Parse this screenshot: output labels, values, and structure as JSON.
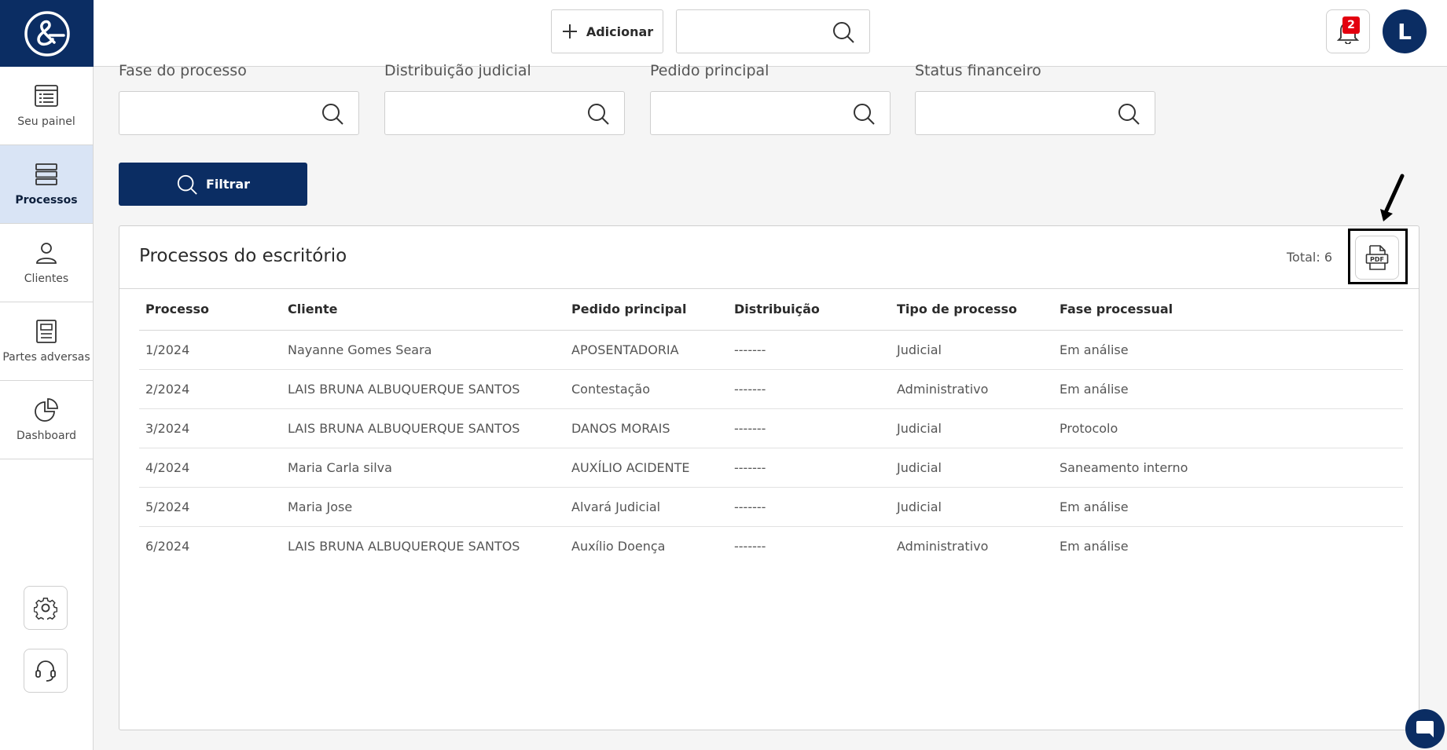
{
  "sidebar": {
    "logo": "ampersand-logo",
    "items": [
      {
        "label": "Seu painel",
        "icon": "list-icon",
        "active": false
      },
      {
        "label": "Processos",
        "icon": "stack-icon",
        "active": true
      },
      {
        "label": "Clientes",
        "icon": "user-icon",
        "active": false
      },
      {
        "label": "Partes adversas",
        "icon": "document-icon",
        "active": false
      },
      {
        "label": "Dashboard",
        "icon": "pie-chart-icon",
        "active": false
      }
    ],
    "bottom_buttons": [
      "gear-icon",
      "headset-icon"
    ]
  },
  "topbar": {
    "add_label": "Adicionar",
    "search_placeholder": "",
    "notifications_count": "2",
    "avatar_initial": "L"
  },
  "filters": {
    "fields": [
      {
        "label": "Fase do processo",
        "value": ""
      },
      {
        "label": "Distribuição judicial",
        "value": ""
      },
      {
        "label": "Pedido principal",
        "value": ""
      },
      {
        "label": "Status financeiro",
        "value": ""
      }
    ],
    "filter_button": "Filtrar"
  },
  "panel": {
    "title": "Processos do escritório",
    "total": "Total: 6",
    "columns": [
      "Processo",
      "Cliente",
      "Pedido principal",
      "Distribuição",
      "Tipo de processo",
      "Fase processual"
    ],
    "rows": [
      [
        "1/2024",
        "Nayanne Gomes Seara",
        "APOSENTADORIA",
        "-------",
        "Judicial",
        "Em análise"
      ],
      [
        "2/2024",
        "LAIS BRUNA ALBUQUERQUE SANTOS",
        "Contestação",
        "-------",
        "Administrativo",
        "Em análise"
      ],
      [
        "3/2024",
        "LAIS BRUNA ALBUQUERQUE SANTOS",
        "DANOS MORAIS",
        "-------",
        "Judicial",
        "Protocolo"
      ],
      [
        "4/2024",
        "Maria Carla silva",
        "AUXÍLIO ACIDENTE",
        "-------",
        "Judicial",
        "Saneamento interno"
      ],
      [
        "5/2024",
        "Maria Jose",
        "Alvará Judicial",
        "-------",
        "Judicial",
        "Em análise"
      ],
      [
        "6/2024",
        "LAIS BRUNA ALBUQUERQUE SANTOS",
        "Auxílio Doença",
        "-------",
        "Administrativo",
        "Em análise"
      ]
    ]
  },
  "colors": {
    "brand": "#0b2d63",
    "active_nav": "#d9e4f5",
    "badge": "#e3000f"
  }
}
